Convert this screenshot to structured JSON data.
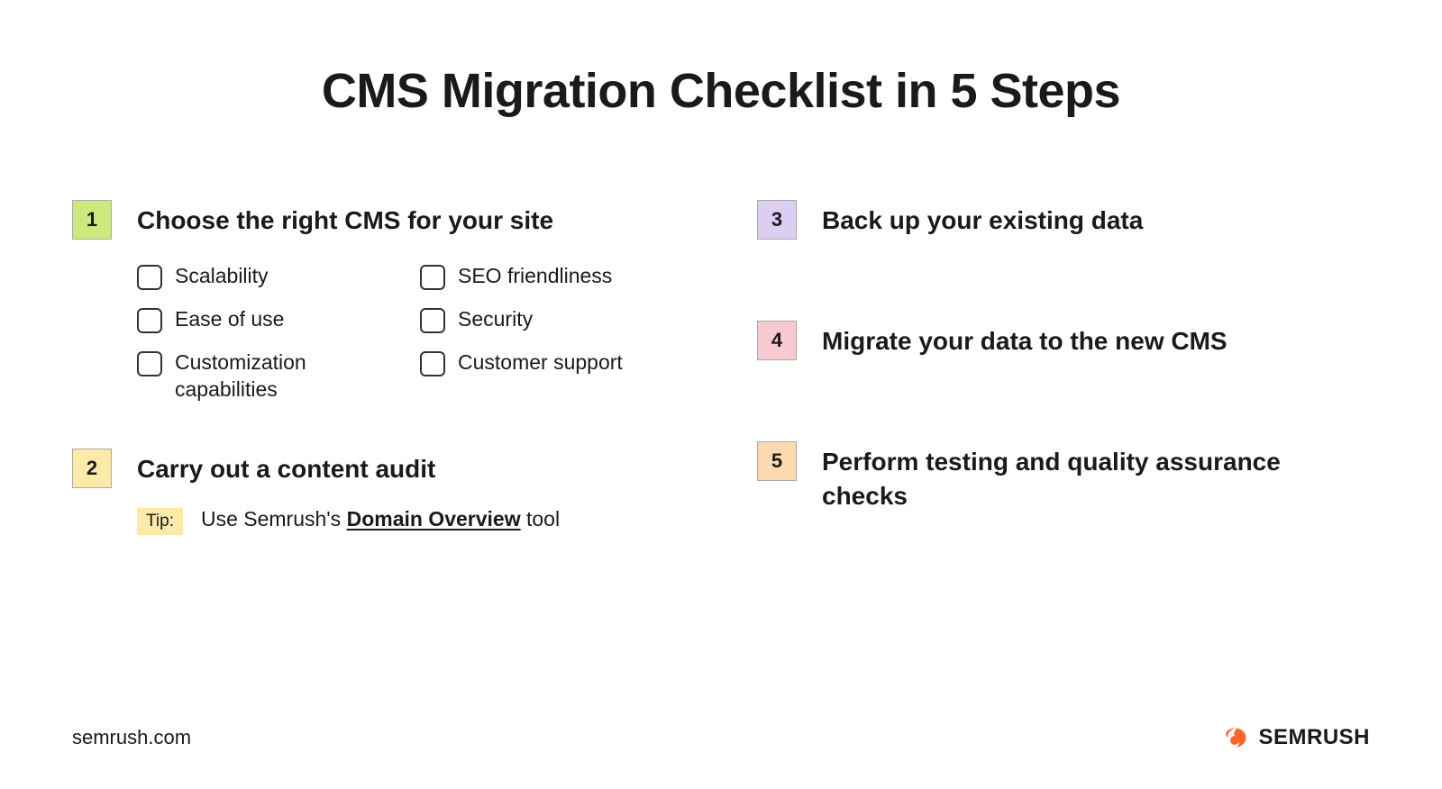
{
  "title": "CMS Migration Checklist in 5 Steps",
  "steps": [
    {
      "num": "1",
      "title": "Choose the right CMS for your site",
      "checks": [
        "Scalability",
        "SEO friendliness",
        "Ease of use",
        "Security",
        "Customization capabilities",
        "Customer support"
      ]
    },
    {
      "num": "2",
      "title": "Carry out a content audit",
      "tip_label": "Tip:",
      "tip_prefix": "Use Semrush's ",
      "tip_link": "Domain Overview",
      "tip_suffix": " tool"
    },
    {
      "num": "3",
      "title": "Back up your existing data"
    },
    {
      "num": "4",
      "title": "Migrate your data to the new CMS"
    },
    {
      "num": "5",
      "title": "Perform testing and quality assurance checks"
    }
  ],
  "footer": {
    "url": "semrush.com",
    "brand": "SEMRUSH"
  }
}
